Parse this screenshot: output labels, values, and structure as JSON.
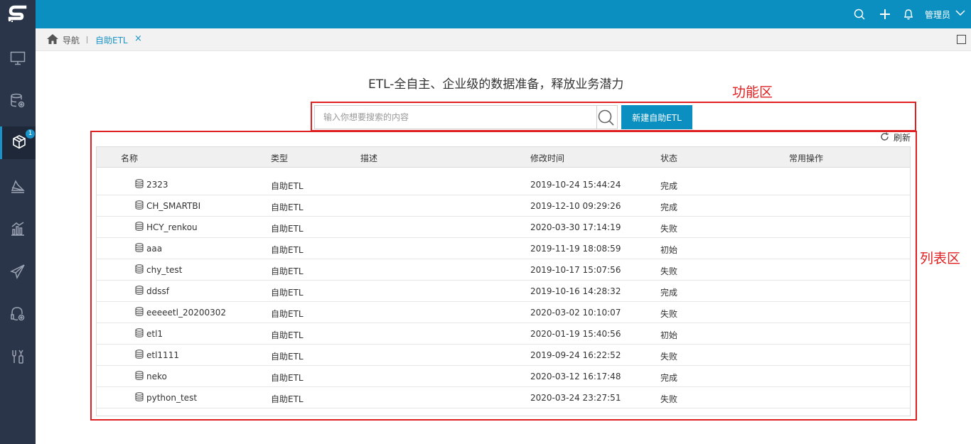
{
  "app": {
    "accent_color": "#0a8fc0",
    "sidebar_color": "#2b3549",
    "logo_icon": "smartbi-logo-icon"
  },
  "sidebar": {
    "items": [
      {
        "icon": "monitor-icon"
      },
      {
        "icon": "database-gear-icon"
      },
      {
        "icon": "cube-icon",
        "badge": "1",
        "active": true
      },
      {
        "icon": "chart-area-icon"
      },
      {
        "icon": "bar-chart-icon"
      },
      {
        "icon": "paper-plane-icon"
      },
      {
        "icon": "headset-gear-icon"
      },
      {
        "icon": "tools-icon"
      }
    ]
  },
  "topbar": {
    "user": "管理员",
    "icons": [
      "search-icon",
      "plus-icon",
      "bell-icon",
      "chevron-down-icon"
    ]
  },
  "breadcrumb": {
    "nav": "导航",
    "tab": "自助ETL",
    "close": "×"
  },
  "headline": "ETL-全自主、企业级的数据准备，释放业务潜力",
  "annotations": {
    "function_area": "功能区",
    "list_area": "列表区"
  },
  "search": {
    "placeholder": "输入你想要搜索的内容",
    "value": ""
  },
  "new_button": "新建自助ETL",
  "refresh": "刷新",
  "table": {
    "headers": [
      "名称",
      "类型",
      "描述",
      "修改时间",
      "状态",
      "常用操作"
    ],
    "rows": [
      {
        "name": "2323",
        "type": "自助ETL",
        "desc": "",
        "time": "2019-10-24 15:44:24",
        "status": "完成"
      },
      {
        "name": "CH_SMARTBI",
        "type": "自助ETL",
        "desc": "",
        "time": "2019-12-10 09:29:26",
        "status": "完成"
      },
      {
        "name": "HCY_renkou",
        "type": "自助ETL",
        "desc": "",
        "time": "2020-03-30 17:14:19",
        "status": "失败"
      },
      {
        "name": "aaa",
        "type": "自助ETL",
        "desc": "",
        "time": "2019-11-19 18:08:59",
        "status": "初始"
      },
      {
        "name": "chy_test",
        "type": "自助ETL",
        "desc": "",
        "time": "2019-10-17 15:07:56",
        "status": "失败"
      },
      {
        "name": "ddssf",
        "type": "自助ETL",
        "desc": "",
        "time": "2019-10-16 14:28:32",
        "status": "完成"
      },
      {
        "name": "eeeeetl_20200302",
        "type": "自助ETL",
        "desc": "",
        "time": "2020-03-02 10:10:07",
        "status": "失败"
      },
      {
        "name": "etl1",
        "type": "自助ETL",
        "desc": "",
        "time": "2020-01-19 15:40:56",
        "status": "初始"
      },
      {
        "name": "etl1111",
        "type": "自助ETL",
        "desc": "",
        "time": "2019-09-24 16:22:52",
        "status": "失败"
      },
      {
        "name": "neko",
        "type": "自助ETL",
        "desc": "",
        "time": "2020-03-12 16:17:48",
        "status": "完成"
      },
      {
        "name": "python_test",
        "type": "自助ETL",
        "desc": "",
        "time": "2020-03-24 23:27:51",
        "status": "失败"
      }
    ]
  }
}
